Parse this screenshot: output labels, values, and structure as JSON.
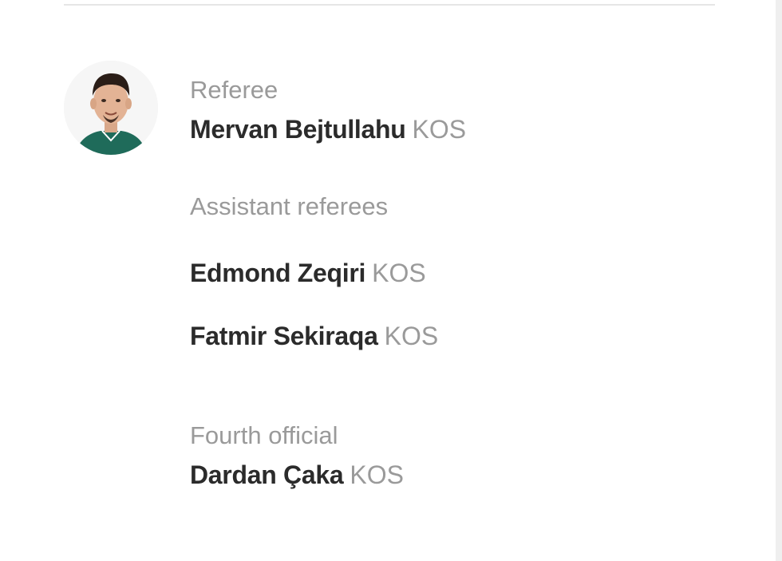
{
  "referee": {
    "label": "Referee",
    "name": "Mervan Bejtullahu",
    "nationality": "KOS"
  },
  "assistants": {
    "label": "Assistant referees",
    "items": [
      {
        "name": "Edmond Zeqiri",
        "nationality": "KOS"
      },
      {
        "name": "Fatmir Sekiraqa",
        "nationality": "KOS"
      }
    ]
  },
  "fourth_official": {
    "label": "Fourth official",
    "name": "Dardan Çaka",
    "nationality": "KOS"
  },
  "colors": {
    "text_primary": "#2b2b2b",
    "text_secondary": "#9a9a9a",
    "jersey_green": "#1f6b5a"
  }
}
